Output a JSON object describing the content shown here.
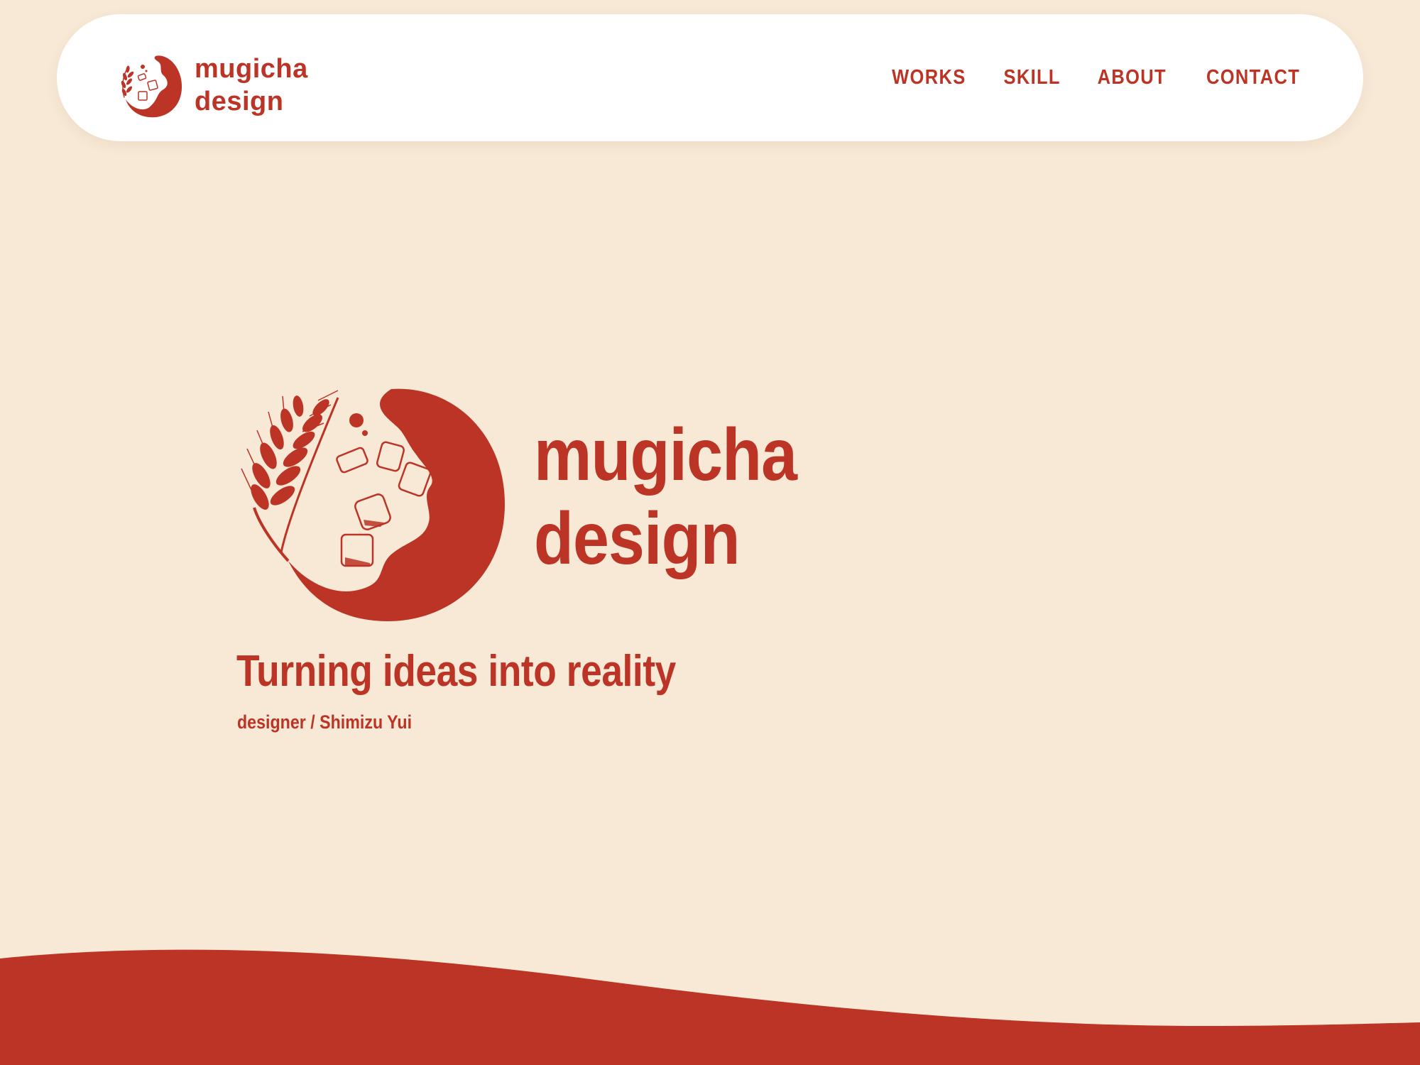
{
  "header": {
    "logo": {
      "icon": "mugicha-logo-icon",
      "line1": "mugicha",
      "line2": "design"
    },
    "nav": [
      {
        "label": "WORKS"
      },
      {
        "label": "SKILL"
      },
      {
        "label": "ABOUT"
      },
      {
        "label": "CONTACT"
      }
    ]
  },
  "hero": {
    "mark_icon": "mugicha-emblem-icon",
    "wordmark_line1": "mugicha",
    "wordmark_line2": "design",
    "tagline": "Turning ideas into reality",
    "byline": "designer / Shimizu Yui"
  },
  "colors": {
    "background": "#f7e9d6",
    "accent": "#bc3425",
    "header_bg": "#ffffff"
  }
}
